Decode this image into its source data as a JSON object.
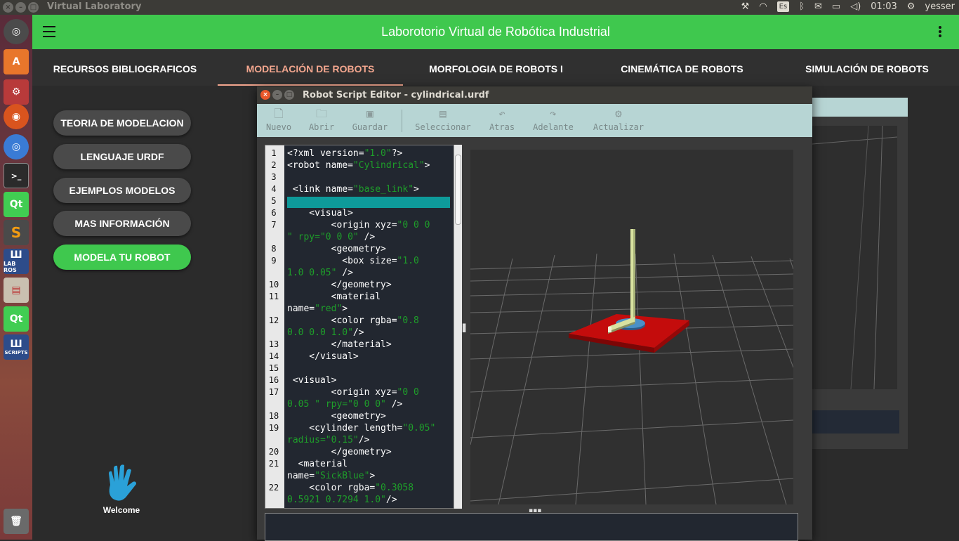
{
  "system_bar": {
    "window_title": "Virtual Laboratory",
    "keyboard": "Es",
    "time": "01:03",
    "user": "yesser"
  },
  "launcher": {
    "items": [
      "ubuntu-icon",
      "software-center-icon",
      "settings-icon",
      "firefox-icon",
      "chromium-icon",
      "terminal-icon",
      "qt-icon",
      "sublime-icon",
      "lab-ros-icon",
      "files-icon",
      "qt-icon",
      "script-icon",
      "trash-icon"
    ],
    "lab_ros_label": "LAB ROS",
    "script_label": "SCRIPTS"
  },
  "header": {
    "title": "Laborotorio Virtual de Robótica Industrial",
    "color": "#3fc84e"
  },
  "tabs": [
    {
      "label": "RECURSOS BIBLIOGRAFICOS"
    },
    {
      "label": "MODELACIÓN DE ROBOTS",
      "active": true
    },
    {
      "label": "MORFOLOGIA DE ROBOTS I"
    },
    {
      "label": "CINEMÁTICA DE ROBOTS"
    },
    {
      "label": "SIMULACIÓN DE ROBOTS"
    }
  ],
  "sidebar": {
    "buttons": [
      {
        "label": "TEORIA DE MODELACION"
      },
      {
        "label": "LENGUAJE URDF"
      },
      {
        "label": "EJEMPLOS MODELOS"
      },
      {
        "label": "MAS INFORMACIÓN"
      },
      {
        "label": "MODELA TU ROBOT",
        "active": true
      }
    ],
    "welcome": "Welcome"
  },
  "editor": {
    "title": "Robot Script Editor - cylindrical.urdf",
    "toolbar": [
      "Nuevo",
      "Abrir",
      "Guardar",
      "Seleccionar",
      "Atras",
      "Adelante",
      "Actualizar"
    ],
    "lines": [
      {
        "n": "1",
        "t": [
          [
            "<?xml version=",
            ""
          ],
          [
            "\"1.0\"",
            "s"
          ],
          [
            "?>",
            ""
          ]
        ]
      },
      {
        "n": "2",
        "t": [
          [
            "<robot name=",
            ""
          ],
          [
            "\"Cylindrical\"",
            "s"
          ],
          [
            ">",
            ""
          ]
        ]
      },
      {
        "n": "3",
        "t": []
      },
      {
        "n": "4",
        "t": [
          [
            " <link name=",
            ""
          ],
          [
            "\"base_link\"",
            "s"
          ],
          [
            ">",
            ""
          ]
        ]
      },
      {
        "n": "5",
        "t": []
      },
      {
        "n": "6",
        "t": [
          [
            "    <visual>",
            ""
          ]
        ]
      },
      {
        "n": "7",
        "t": [
          [
            "        <origin xyz=",
            ""
          ],
          [
            "\"0 0 0",
            "s"
          ]
        ]
      },
      {
        "n": "",
        "t": [
          [
            "\" rpy=\"0 0 0\"",
            "s"
          ],
          [
            " />",
            ""
          ]
        ]
      },
      {
        "n": "8",
        "t": [
          [
            "        <geometry>",
            ""
          ]
        ]
      },
      {
        "n": "9",
        "t": [
          [
            "          <box size=",
            ""
          ],
          [
            "\"1.0",
            "s"
          ]
        ]
      },
      {
        "n": "",
        "t": [
          [
            "1.0 0.05\"",
            "s"
          ],
          [
            " />",
            ""
          ]
        ]
      },
      {
        "n": "10",
        "t": [
          [
            "        </geometry>",
            ""
          ]
        ]
      },
      {
        "n": "11",
        "t": [
          [
            "        <material",
            ""
          ]
        ]
      },
      {
        "n": "",
        "t": [
          [
            "name=",
            ""
          ],
          [
            "\"red\"",
            "s"
          ],
          [
            ">",
            ""
          ]
        ]
      },
      {
        "n": "12",
        "t": [
          [
            "        <color rgba=",
            ""
          ],
          [
            "\"0.8",
            "s"
          ]
        ]
      },
      {
        "n": "",
        "t": [
          [
            "0.0 0.0 1.0\"",
            "s"
          ],
          [
            "/>",
            ""
          ]
        ]
      },
      {
        "n": "13",
        "t": [
          [
            "        </material>",
            ""
          ]
        ]
      },
      {
        "n": "14",
        "t": [
          [
            "    </visual>",
            ""
          ]
        ]
      },
      {
        "n": "15",
        "t": []
      },
      {
        "n": "16",
        "t": [
          [
            " <visual>",
            ""
          ]
        ]
      },
      {
        "n": "17",
        "t": [
          [
            "        <origin xyz=",
            ""
          ],
          [
            "\"0 0",
            "s"
          ]
        ]
      },
      {
        "n": "",
        "t": [
          [
            "0.05 \" rpy=\"0 0 0\"",
            "s"
          ],
          [
            " />",
            ""
          ]
        ]
      },
      {
        "n": "18",
        "t": [
          [
            "        <geometry>",
            ""
          ]
        ]
      },
      {
        "n": "19",
        "t": [
          [
            "    <cylinder length=",
            ""
          ],
          [
            "\"0.05\"",
            "s"
          ]
        ]
      },
      {
        "n": "",
        "t": [
          [
            "radius=\"0.15\"",
            "s"
          ],
          [
            "/>",
            ""
          ]
        ]
      },
      {
        "n": "20",
        "t": [
          [
            "        </geometry>",
            ""
          ]
        ]
      },
      {
        "n": "21",
        "t": [
          [
            "  <material",
            ""
          ]
        ]
      },
      {
        "n": "",
        "t": [
          [
            "name=",
            ""
          ],
          [
            "\"SickBlue\"",
            "s"
          ],
          [
            ">",
            ""
          ]
        ]
      },
      {
        "n": "22",
        "t": [
          [
            "    <color rgba=",
            ""
          ],
          [
            "\"0.3058",
            "s"
          ]
        ]
      },
      {
        "n": "",
        "t": [
          [
            "0.5921 0.7294 1.0\"",
            "s"
          ],
          [
            "/>",
            ""
          ]
        ]
      }
    ]
  }
}
